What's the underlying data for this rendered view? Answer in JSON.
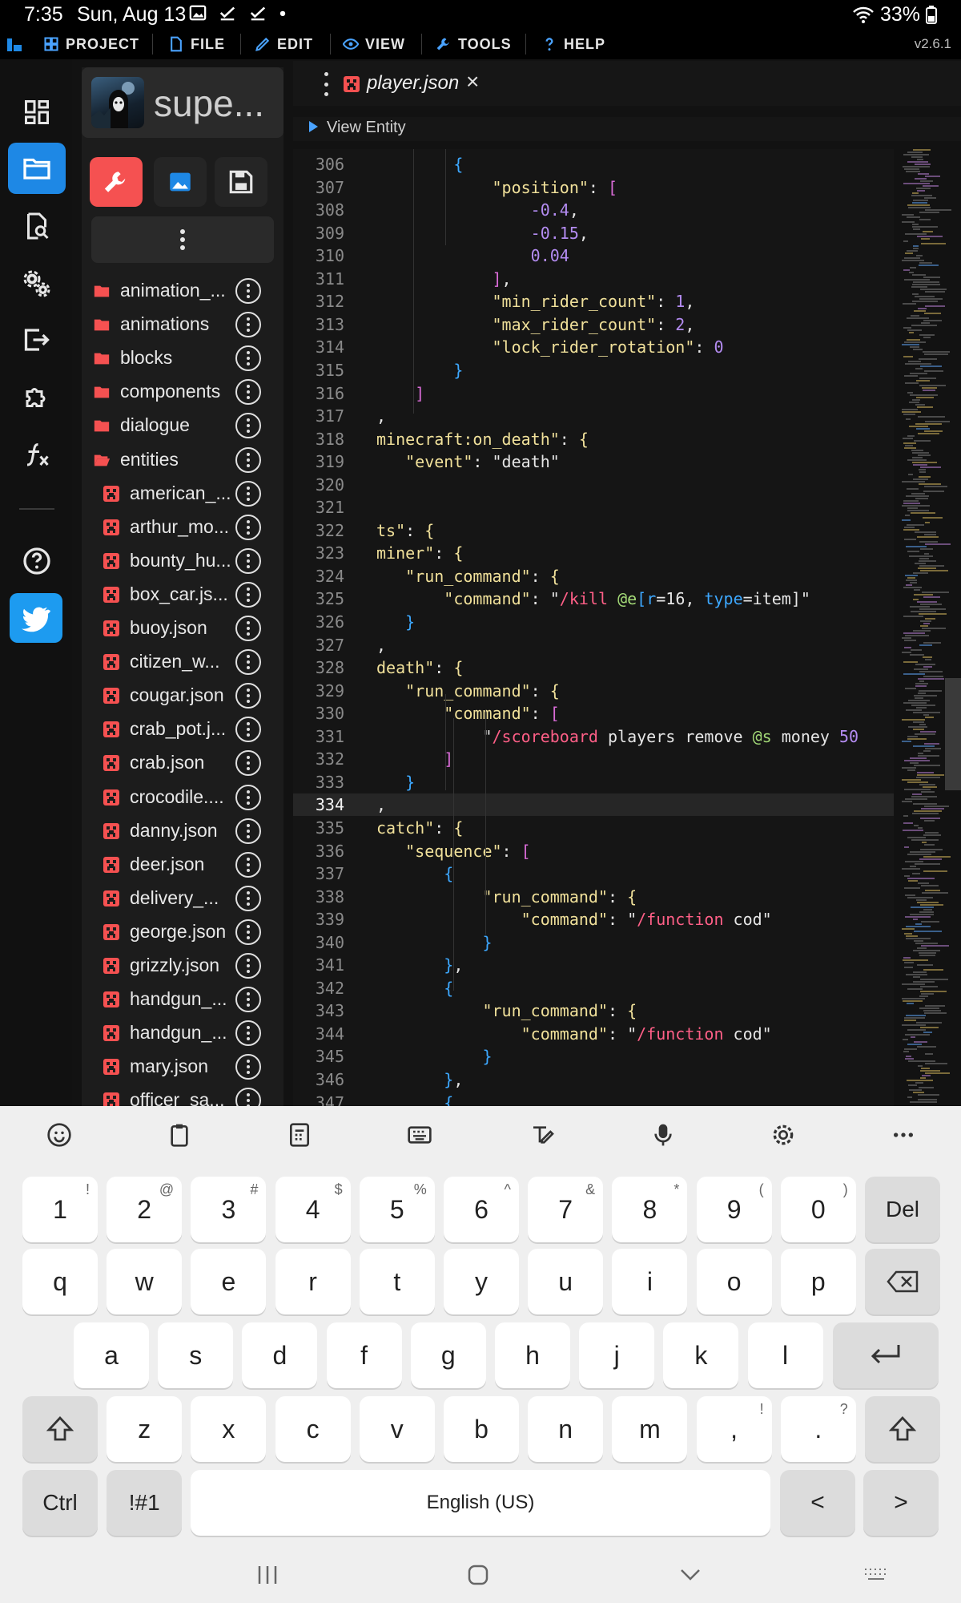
{
  "status_bar": {
    "time": "7:35",
    "date": "Sun, Aug 13",
    "battery": "33%"
  },
  "menubar": {
    "items": [
      {
        "label": "PROJECT",
        "icon": "grid-icon"
      },
      {
        "label": "FILE",
        "icon": "file-icon"
      },
      {
        "label": "EDIT",
        "icon": "pencil-icon"
      },
      {
        "label": "VIEW",
        "icon": "eye-icon"
      },
      {
        "label": "TOOLS",
        "icon": "wrench-icon"
      },
      {
        "label": "HELP",
        "icon": "question-icon"
      }
    ],
    "version": "v2.6.1"
  },
  "sidebar": {
    "project_name": "supe...",
    "folders": [
      "animation_...",
      "animations",
      "blocks",
      "components",
      "dialogue",
      "entities"
    ],
    "files": [
      "american_...",
      "arthur_mo...",
      "bounty_hu...",
      "box_car.js...",
      "buoy.json",
      "citizen_w...",
      "cougar.json",
      "crab_pot.j...",
      "crab.json",
      "crocodile....",
      "danny.json",
      "deer.json",
      "delivery_...",
      "george.json",
      "grizzly.json",
      "handgun_...",
      "handgun_...",
      "mary.json",
      "officer_sa..."
    ]
  },
  "editor": {
    "tab_title": "player.json",
    "tab_close": "×",
    "view_entity_label": "View Entity",
    "current_line": 334,
    "lines": [
      {
        "n": "306",
        "t": "        {"
      },
      {
        "n": "307",
        "t": "            \"position\": ["
      },
      {
        "n": "308",
        "t": "                -0.4,"
      },
      {
        "n": "309",
        "t": "                -0.15,"
      },
      {
        "n": "310",
        "t": "                0.04"
      },
      {
        "n": "311",
        "t": "            ],"
      },
      {
        "n": "312",
        "t": "            \"min_rider_count\": 1,"
      },
      {
        "n": "313",
        "t": "            \"max_rider_count\": 2,"
      },
      {
        "n": "314",
        "t": "            \"lock_rider_rotation\": 0"
      },
      {
        "n": "315",
        "t": "        }"
      },
      {
        "n": "316",
        "t": "    ]"
      },
      {
        "n": "317",
        "t": ","
      },
      {
        "n": "318",
        "t": "minecraft:on_death\": {"
      },
      {
        "n": "319",
        "t": "   \"event\": \"death\""
      },
      {
        "n": "320",
        "t": ""
      },
      {
        "n": "321",
        "t": ""
      },
      {
        "n": "322",
        "t": "ts\": {"
      },
      {
        "n": "323",
        "t": "miner\": {"
      },
      {
        "n": "324",
        "t": "   \"run_command\": {"
      },
      {
        "n": "325",
        "t": "       \"command\": \"/kill @e[r=16, type=item]\""
      },
      {
        "n": "326",
        "t": "   }"
      },
      {
        "n": "327",
        "t": ","
      },
      {
        "n": "328",
        "t": "death\": {"
      },
      {
        "n": "329",
        "t": "   \"run_command\": {"
      },
      {
        "n": "330",
        "t": "       \"command\": ["
      },
      {
        "n": "331",
        "t": "           \"/scoreboard players remove @s money 50"
      },
      {
        "n": "332",
        "t": "       ]"
      },
      {
        "n": "333",
        "t": "   }"
      },
      {
        "n": "334",
        "t": ","
      },
      {
        "n": "335",
        "t": "catch\": {"
      },
      {
        "n": "336",
        "t": "   \"sequence\": ["
      },
      {
        "n": "337",
        "t": "       {"
      },
      {
        "n": "338",
        "t": "           \"run_command\": {"
      },
      {
        "n": "339",
        "t": "               \"command\": \"/function cod\""
      },
      {
        "n": "340",
        "t": "           }"
      },
      {
        "n": "341",
        "t": "       },"
      },
      {
        "n": "342",
        "t": "       {"
      },
      {
        "n": "343",
        "t": "           \"run_command\": {"
      },
      {
        "n": "344",
        "t": "               \"command\": \"/function cod\""
      },
      {
        "n": "345",
        "t": "           }"
      },
      {
        "n": "346",
        "t": "       },"
      },
      {
        "n": "347",
        "t": "       {"
      }
    ]
  },
  "keyboard": {
    "row_numbers": [
      {
        "k": "1",
        "s": "!"
      },
      {
        "k": "2",
        "s": "@"
      },
      {
        "k": "3",
        "s": "#"
      },
      {
        "k": "4",
        "s": "$"
      },
      {
        "k": "5",
        "s": "%"
      },
      {
        "k": "6",
        "s": "^"
      },
      {
        "k": "7",
        "s": "&"
      },
      {
        "k": "8",
        "s": "*"
      },
      {
        "k": "9",
        "s": "("
      },
      {
        "k": "0",
        "s": ")"
      }
    ],
    "del_label": "Del",
    "row_q": [
      "q",
      "w",
      "e",
      "r",
      "t",
      "y",
      "u",
      "i",
      "o",
      "p"
    ],
    "row_a": [
      "a",
      "s",
      "d",
      "f",
      "g",
      "h",
      "j",
      "k",
      "l"
    ],
    "row_z": [
      "z",
      "x",
      "c",
      "v",
      "b",
      "n",
      "m"
    ],
    "comma": ",",
    "comma_sup": "!",
    "period": ".",
    "period_sup": "?",
    "ctrl_label": "Ctrl",
    "symbols_label": "!#1",
    "space_label": "English (US)",
    "left_arrow": "<",
    "right_arrow": ">"
  }
}
